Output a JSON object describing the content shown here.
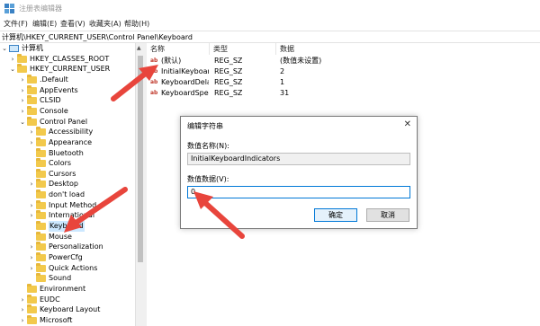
{
  "window": {
    "title": "注册表编辑器"
  },
  "menu": [
    "文件(F)",
    "编辑(E)",
    "查看(V)",
    "收藏夹(A)",
    "帮助(H)"
  ],
  "address": "计算机\\HKEY_CURRENT_USER\\Control Panel\\Keyboard",
  "tree": [
    {
      "label": "计算机",
      "type": "pc",
      "expander": "⌄",
      "level": 0
    },
    {
      "label": "HKEY_CLASSES_ROOT",
      "type": "folder",
      "expander": "›",
      "level": 1
    },
    {
      "label": "HKEY_CURRENT_USER",
      "type": "folder",
      "expander": "⌄",
      "level": 1
    },
    {
      "label": ".Default",
      "type": "folder",
      "expander": "›",
      "level": 2
    },
    {
      "label": "AppEvents",
      "type": "folder",
      "expander": "›",
      "level": 2
    },
    {
      "label": "CLSID",
      "type": "folder",
      "expander": "›",
      "level": 2
    },
    {
      "label": "Console",
      "type": "folder",
      "expander": "›",
      "level": 2
    },
    {
      "label": "Control Panel",
      "type": "folder",
      "expander": "⌄",
      "level": 2
    },
    {
      "label": "Accessibility",
      "type": "folder",
      "expander": "›",
      "level": 3
    },
    {
      "label": "Appearance",
      "type": "folder",
      "expander": "›",
      "level": 3
    },
    {
      "label": "Bluetooth",
      "type": "folder",
      "expander": "",
      "level": 3
    },
    {
      "label": "Colors",
      "type": "folder",
      "expander": "",
      "level": 3
    },
    {
      "label": "Cursors",
      "type": "folder",
      "expander": "",
      "level": 3
    },
    {
      "label": "Desktop",
      "type": "folder",
      "expander": "›",
      "level": 3
    },
    {
      "label": "don't load",
      "type": "folder",
      "expander": "",
      "level": 3
    },
    {
      "label": "Input Method",
      "type": "folder",
      "expander": "›",
      "level": 3
    },
    {
      "label": "International",
      "type": "folder",
      "expander": "›",
      "level": 3
    },
    {
      "label": "Keyboard",
      "type": "folder",
      "expander": "",
      "level": 3,
      "selected": true
    },
    {
      "label": "Mouse",
      "type": "folder",
      "expander": "",
      "level": 3
    },
    {
      "label": "Personalization",
      "type": "folder",
      "expander": "›",
      "level": 3
    },
    {
      "label": "PowerCfg",
      "type": "folder",
      "expander": "›",
      "level": 3
    },
    {
      "label": "Quick Actions",
      "type": "folder",
      "expander": "›",
      "level": 3
    },
    {
      "label": "Sound",
      "type": "folder",
      "expander": "",
      "level": 3
    },
    {
      "label": "Environment",
      "type": "folder",
      "expander": "",
      "level": 2
    },
    {
      "label": "EUDC",
      "type": "folder",
      "expander": "›",
      "level": 2
    },
    {
      "label": "Keyboard Layout",
      "type": "folder",
      "expander": "›",
      "level": 2
    },
    {
      "label": "Microsoft",
      "type": "folder",
      "expander": "›",
      "level": 2
    }
  ],
  "columns": [
    "名称",
    "类型",
    "数据"
  ],
  "values": [
    {
      "name": "(默认)",
      "type": "REG_SZ",
      "data": "(数值未设置)"
    },
    {
      "name": "InitialKeyboardIndicators",
      "type": "REG_SZ",
      "data": "2"
    },
    {
      "name": "KeyboardDelay",
      "type": "REG_SZ",
      "data": "1"
    },
    {
      "name": "KeyboardSpeed",
      "type": "REG_SZ",
      "data": "31"
    }
  ],
  "dialog": {
    "title": "编辑字符串",
    "close": "✕",
    "name_label": "数值名称(N):",
    "name_value": "InitialKeyboardIndicators",
    "data_label": "数值数据(V):",
    "data_value": "0",
    "ok": "确定",
    "cancel": "取消"
  },
  "colors": {
    "arrow": "#e8453c",
    "accent": "#0078d7",
    "folder": "#f2c94c"
  }
}
